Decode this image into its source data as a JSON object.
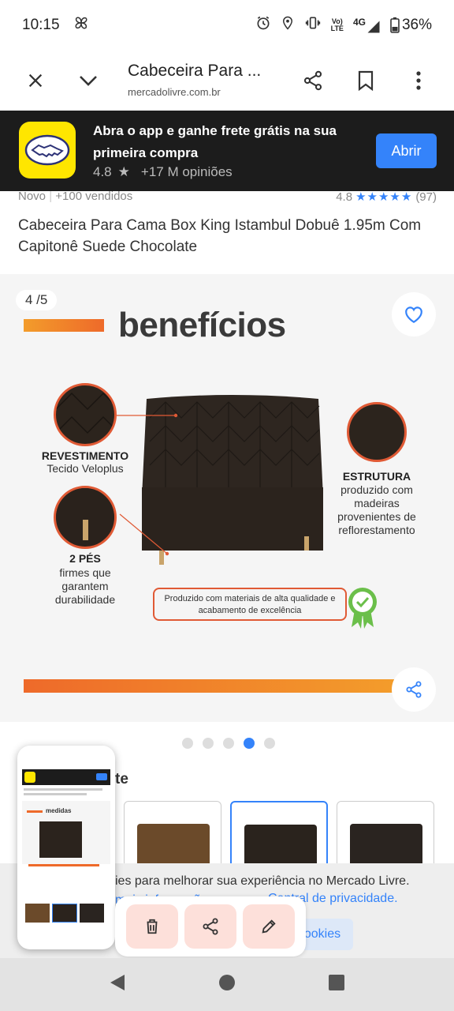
{
  "status": {
    "time": "10:15",
    "net_top": "Vo)",
    "net_bottom": "LTE",
    "net_type": "4G",
    "battery": "36%"
  },
  "browser": {
    "title": "Cabeceira Para ...",
    "domain": "mercadolivre.com.br"
  },
  "app_banner": {
    "text": "Abra o app e ganhe frete grátis na sua primeira compra",
    "rating": "4.8",
    "reviews": "+17 M opiniões",
    "button": "Abrir"
  },
  "product": {
    "condition": "Novo",
    "sold": "+100 vendidos",
    "rating": "4.8",
    "stars": "★★★★★",
    "reviews_count": "(97)",
    "title": "Cabeceira Para Cama Box King Istambul Dobuê 1.95m Com Capitonê Suede Chocolate"
  },
  "gallery": {
    "counter": "4 /5",
    "heading": "benefícios",
    "features": {
      "revestimento_title": "REVESTIMENTO",
      "revestimento_desc": "Tecido Veloplus",
      "pes_title": "2 PÉS",
      "pes_desc": "firmes que garantem durabilidade",
      "estrutura_title": "ESTRUTURA",
      "estrutura_desc": "produzido com madeiras provenientes de reflorestamento"
    },
    "quality": "Produzido com materiais de alta qualidade e acabamento de excelência",
    "dots_total": 5,
    "dots_active": 4
  },
  "color": {
    "label_suffix": "te"
  },
  "cookie": {
    "text": "ies para melhorar sua experiência no Mercado Livre.",
    "link": "Central de privacidade.",
    "link_prefix": "mais informações",
    "button": "ookies"
  },
  "screenshot_preview": {
    "heading": "medidas"
  },
  "colors": {
    "accent": "#3483fa",
    "brand_yellow": "#ffe600",
    "orange": "#ee6a2a",
    "banner_bg": "#1c1c1c"
  }
}
